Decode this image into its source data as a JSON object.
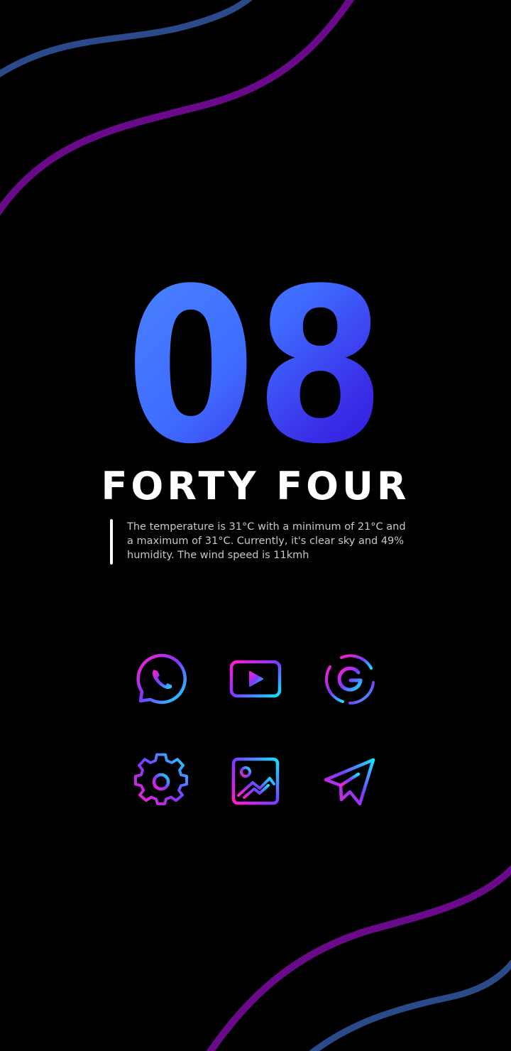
{
  "clock": {
    "hour": "08",
    "minutes_words": "FORTY FOUR"
  },
  "weather": {
    "summary": "The temperature is 31°C with a minimum of 21°C and a maximum of 31°C. Currently, it's clear sky and 49% humidity. The wind speed is 11kmh"
  },
  "apps": [
    {
      "icon": "whatsapp-icon"
    },
    {
      "icon": "youtube-icon"
    },
    {
      "icon": "google-icon"
    },
    {
      "icon": "settings-icon"
    },
    {
      "icon": "gallery-icon"
    },
    {
      "icon": "telegram-icon"
    }
  ],
  "colors": {
    "background": "#000000",
    "wave_purple": "#6a0a8a",
    "wave_blue": "#2a4a8a",
    "digits_light": "#3f7bff",
    "digits_dark": "#3010d8",
    "icon_gradient_start": "#ff1fc8",
    "icon_gradient_end": "#12e4ff"
  }
}
